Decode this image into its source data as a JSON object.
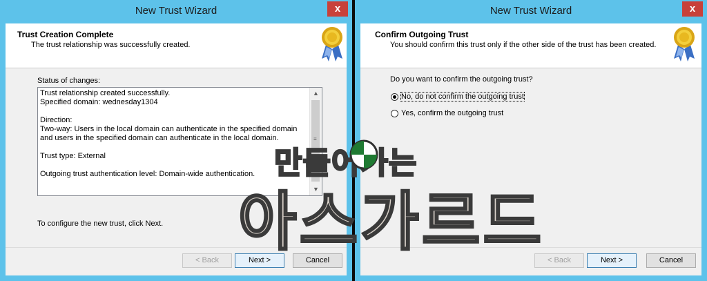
{
  "left_window": {
    "title": "New Trust Wizard",
    "close_glyph": "x",
    "header_title": "Trust Creation Complete",
    "header_subtitle": "The trust relationship was successfully created.",
    "status_label": "Status of changes:",
    "status_lines": [
      "Trust relationship created successfully.",
      "Specified domain: wednesday1304",
      "",
      "Direction:",
      "Two-way: Users in the local domain can authenticate in the specified domain and users in the specified domain can authenticate in the local domain.",
      "",
      "Trust type: External",
      "",
      "Outgoing trust authentication level: Domain-wide authentication."
    ],
    "instruction": "To configure the new trust, click Next.",
    "back_label": "< Back",
    "next_label": "Next >",
    "cancel_label": "Cancel",
    "back_enabled": false
  },
  "right_window": {
    "title": "New Trust Wizard",
    "close_glyph": "x",
    "header_title": "Confirm Outgoing Trust",
    "header_subtitle": "You should confirm this trust only if the other side of the trust has been created.",
    "question": "Do you want to confirm the outgoing trust?",
    "options": [
      {
        "label": "No, do not confirm the outgoing trust",
        "selected": true
      },
      {
        "label": "Yes, confirm the outgoing trust",
        "selected": false
      }
    ],
    "back_label": "< Back",
    "next_label": "Next >",
    "cancel_label": "Cancel",
    "back_enabled": false
  },
  "watermark": {
    "line1": "만들어가는",
    "line2": "아스가르드"
  },
  "colors": {
    "window_frame": "#5dc2ea",
    "close_button": "#c8413a",
    "dialog_bg": "#f0f0f0"
  },
  "icons": {
    "header_badge": "award-medal-icon",
    "scroll_up": "chevron-up-icon",
    "scroll_down": "chevron-down-icon"
  }
}
